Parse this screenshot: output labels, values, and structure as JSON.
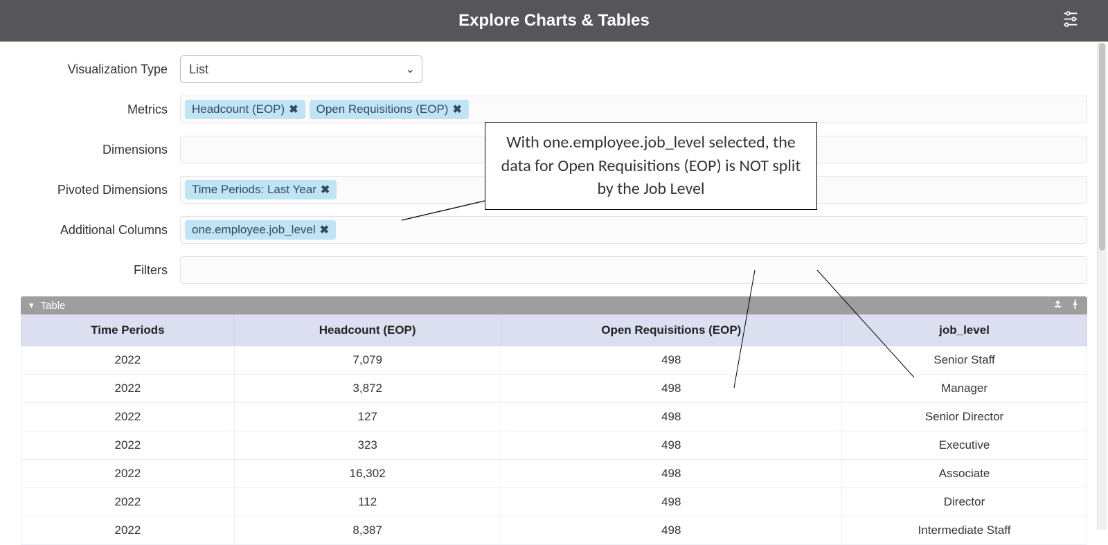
{
  "header": {
    "title": "Explore Charts & Tables",
    "settings_icon": "settings-sliders-icon"
  },
  "form": {
    "visualization_type": {
      "label": "Visualization Type",
      "value": "List"
    },
    "metrics": {
      "label": "Metrics",
      "tokens": [
        {
          "text": "Headcount (EOP)"
        },
        {
          "text": "Open Requisitions (EOP)"
        }
      ]
    },
    "dimensions": {
      "label": "Dimensions",
      "tokens": []
    },
    "pivoted_dimensions": {
      "label": "Pivoted Dimensions",
      "tokens": [
        {
          "text": "Time Periods: Last Year"
        }
      ]
    },
    "additional_columns": {
      "label": "Additional Columns",
      "tokens": [
        {
          "text": "one.employee.job_level"
        }
      ]
    },
    "filters": {
      "label": "Filters",
      "tokens": []
    }
  },
  "panel": {
    "title": "Table"
  },
  "table": {
    "columns": [
      "Time Periods",
      "Headcount (EOP)",
      "Open Requisitions (EOP)",
      "job_level"
    ],
    "rows": [
      {
        "time": "2022",
        "headcount": "7,079",
        "open_req": "498",
        "job_level": "Senior Staff"
      },
      {
        "time": "2022",
        "headcount": "3,872",
        "open_req": "498",
        "job_level": "Manager"
      },
      {
        "time": "2022",
        "headcount": "127",
        "open_req": "498",
        "job_level": "Senior Director"
      },
      {
        "time": "2022",
        "headcount": "323",
        "open_req": "498",
        "job_level": "Executive"
      },
      {
        "time": "2022",
        "headcount": "16,302",
        "open_req": "498",
        "job_level": "Associate"
      },
      {
        "time": "2022",
        "headcount": "112",
        "open_req": "498",
        "job_level": "Director"
      },
      {
        "time": "2022",
        "headcount": "8,387",
        "open_req": "498",
        "job_level": "Intermediate Staff"
      }
    ]
  },
  "callout": {
    "text": "With one.employee.job_level selected, the data for Open Requisitions (EOP) is NOT split by the Job Level"
  }
}
